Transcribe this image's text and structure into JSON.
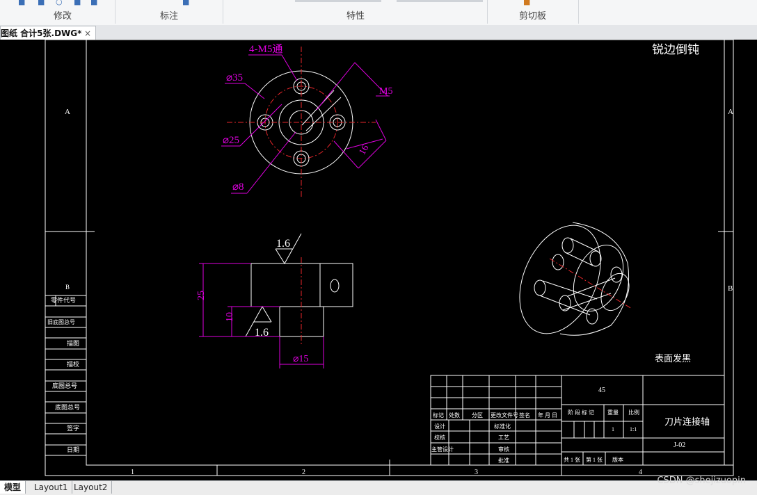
{
  "ribbon": {
    "groups": [
      {
        "label": "修改"
      },
      {
        "label": "标注"
      },
      {
        "label": "特性"
      },
      {
        "label": "剪切板"
      }
    ]
  },
  "document_tab": {
    "title": "图纸 合计5张.DWG*",
    "close_glyph": "×"
  },
  "drawing": {
    "top_view": {
      "callout_holes": "4-M5通",
      "dia_35": "⌀35",
      "dia_25": "⌀25",
      "dia_8": "⌀8",
      "m5": "M5",
      "dim_16": "16"
    },
    "front_view": {
      "roughness_top": "1.6",
      "roughness_bottom": "1.6",
      "dim_25": "25",
      "dim_10": "10",
      "dia_15": "⌀15"
    },
    "note_edges": "锐边倒钝",
    "note_surface": "表面发黑",
    "zone_letters": {
      "a": "A",
      "b": "B"
    },
    "column_numbers": [
      "1",
      "2",
      "3",
      "4"
    ],
    "left_strip": {
      "zone_b": "B",
      "rows": [
        "零件代号",
        "旧底图总号",
        "描图",
        "描校",
        "底图总号",
        "底图总号",
        "签字",
        "日期"
      ]
    },
    "title_block": {
      "material": "45",
      "part_name": "刀片连接轴",
      "drawing_no": "J-02",
      "row_labels": [
        "标记",
        "处数",
        "分区",
        "更改文件号",
        "签名",
        "年 月 日"
      ],
      "roles": [
        "设计",
        "校核",
        "主管设计"
      ],
      "roles2": [
        "标准化",
        "工艺",
        "审核",
        "批准"
      ],
      "stage": "阶 段 标 记",
      "weight": "重量",
      "scale": "比例",
      "scale_value": "1:1",
      "weight_value": "1",
      "sheets_total": "共 1 张",
      "sheet_no": "第 1 张",
      "version": "版本"
    }
  },
  "layout_tabs": [
    "模型",
    "Layout1",
    "Layout2"
  ],
  "watermark": "CSDN @shejizuopin",
  "colors": {
    "background": "#000000",
    "geometry": "#ffffff",
    "centerline": "#e8262a",
    "dimension": "#e000e0"
  }
}
